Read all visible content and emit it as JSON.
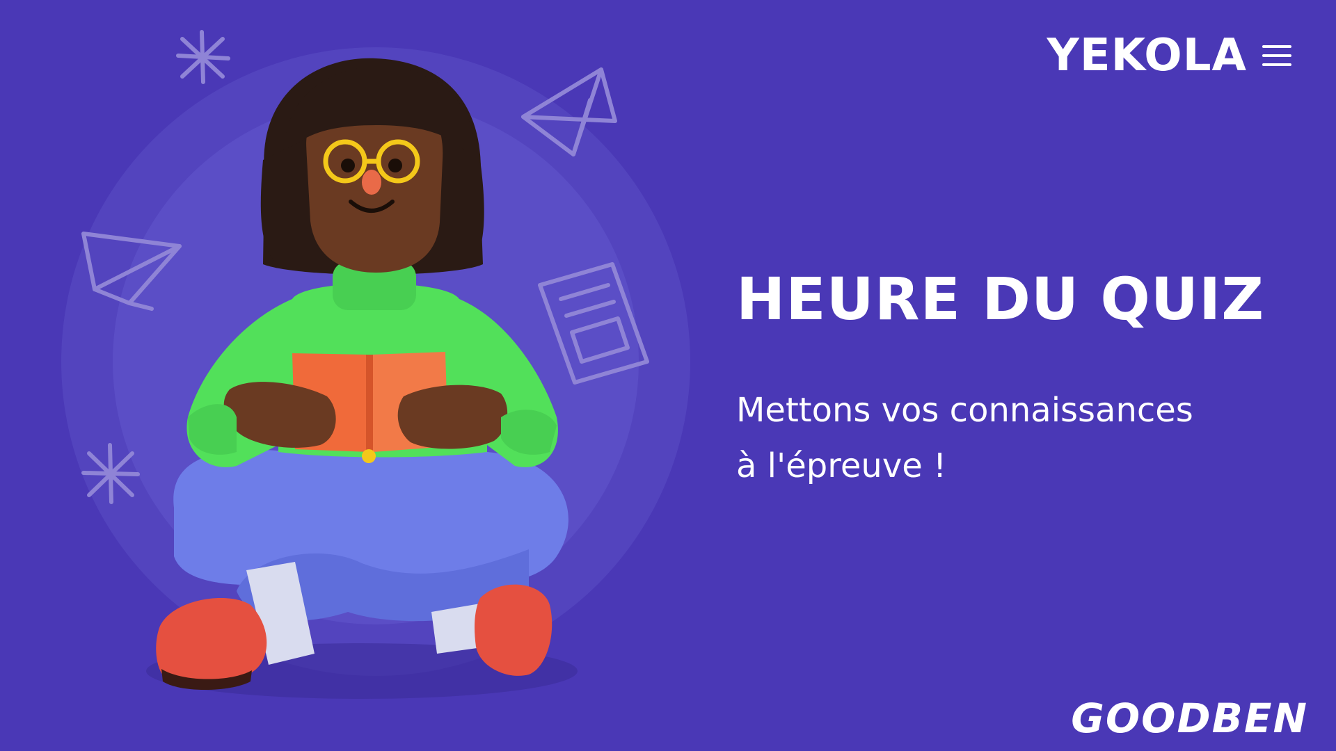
{
  "brand": {
    "name": "YEKOLA",
    "menu_icon": "hamburger-menu-icon"
  },
  "hero": {
    "title": "HEURE DU QUIZ",
    "subtitle_line1": "Mettons vos connaissances",
    "subtitle_line2": "à l'épreuve !"
  },
  "footer": {
    "signature": "GOODBEN"
  },
  "colors": {
    "background": "#4a38b6",
    "text": "#ffffff",
    "sweater": "#52e05a",
    "jeans": "#6e7de8",
    "book": "#f06a3a",
    "shoes": "#e55040",
    "skin": "#6a3a22",
    "hair": "#2a1a14",
    "glasses": "#f4c81a",
    "doodle": "#8f84d6"
  },
  "illustration": {
    "subject": "person-reading-book",
    "decorations": [
      "sparkle-icon",
      "paper-plane-icon",
      "document-icon"
    ]
  }
}
